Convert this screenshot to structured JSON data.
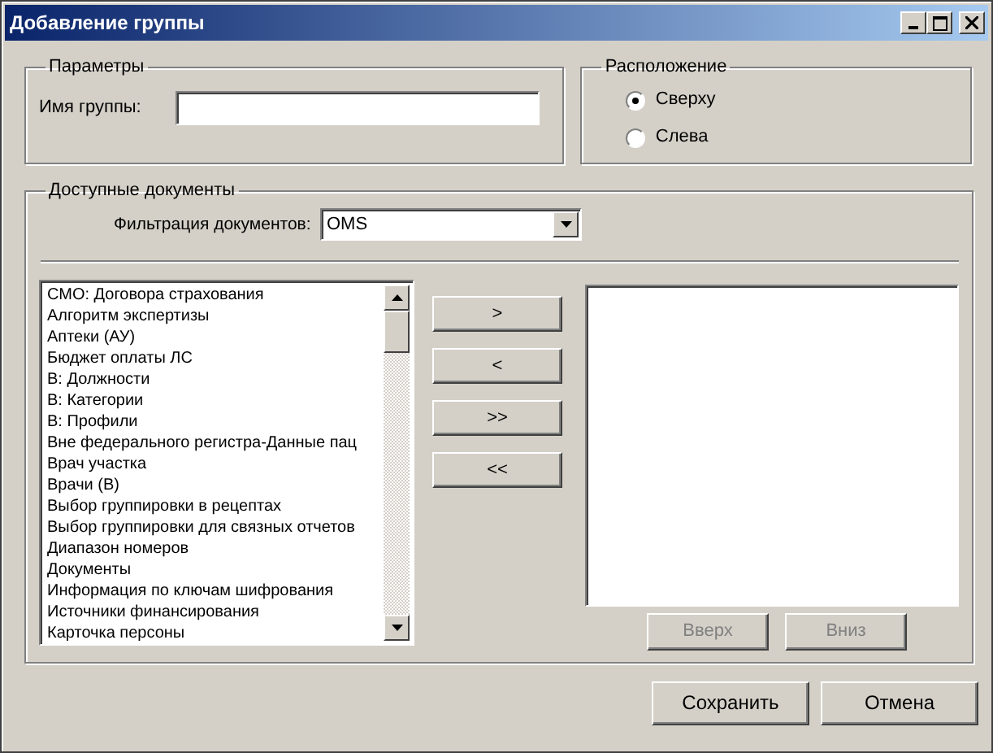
{
  "window": {
    "title": "Добавление группы"
  },
  "parameters": {
    "title": "Параметры",
    "group_name": {
      "label": "Имя группы:"
    }
  },
  "placement": {
    "title": "Расположение",
    "options": [
      {
        "label": "Сверху",
        "selected": true
      },
      {
        "label": "Слева",
        "selected": false
      }
    ]
  },
  "documents": {
    "title": "Доступные документы",
    "filter": {
      "label": "Фильтрация документов:",
      "value": "OMS"
    },
    "available": [
      "СМО: Договора страхования",
      "Алгоритм экспертизы",
      "Аптеки (АУ)",
      "Бюджет оплаты ЛС",
      "В: Должности",
      "В: Категории",
      "В: Профили",
      "Вне федерального регистра-Данные пац",
      "Врач участка",
      "Врачи (В)",
      "Выбор группировки в рецептах",
      "Выбор группировки для связных отчетов",
      "Диапазон номеров",
      "Документы",
      "Информация по ключам шифрования",
      "Источники финансирования",
      "Карточка персоны"
    ],
    "transfer_buttons": [
      ">",
      "<",
      ">>",
      "<<"
    ],
    "order_buttons": [
      {
        "label": "Вверх",
        "disabled": true
      },
      {
        "label": "Вниз",
        "disabled": true
      }
    ]
  },
  "buttons": [
    "Сохранить",
    "Отмена"
  ]
}
